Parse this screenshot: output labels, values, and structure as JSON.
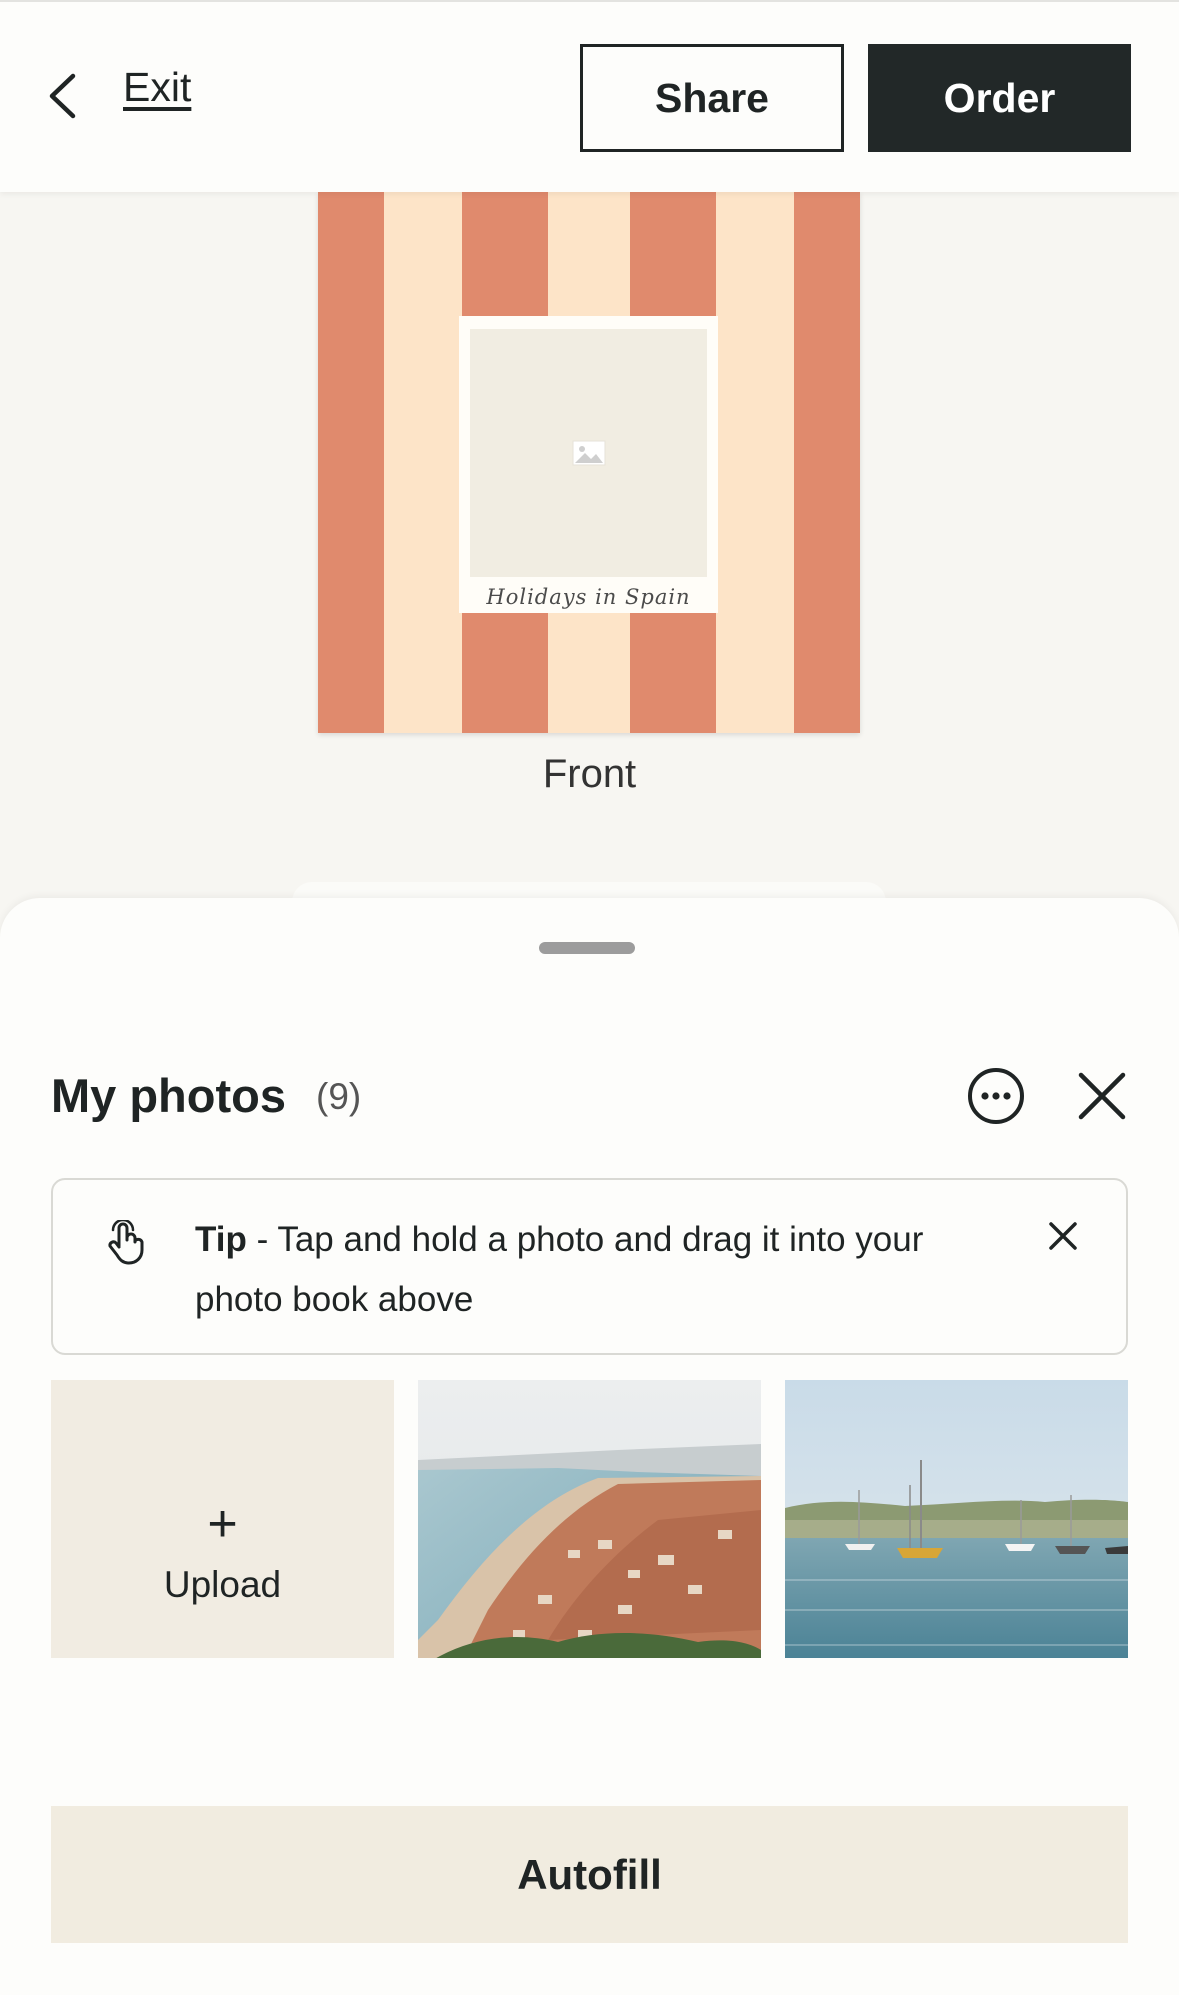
{
  "header": {
    "exit_label": "Exit",
    "share_label": "Share",
    "order_label": "Order"
  },
  "cover": {
    "title": "Holidays in Spain",
    "page_label": "Front"
  },
  "sheet": {
    "title": "My photos",
    "count": "(9)",
    "tip": {
      "label": "Tip",
      "text": " - Tap and hold a photo and drag it into your photo book above"
    },
    "upload_label": "Upload",
    "upload_icon": "+",
    "autofill_label": "Autofill"
  },
  "photos": [
    {
      "name": "coastal-city-photo"
    },
    {
      "name": "harbor-boats-photo"
    }
  ],
  "colors": {
    "terracotta": "#e08a6d",
    "cream": "#fde4c8",
    "dark": "#222828",
    "sand": "#f1ece0"
  }
}
